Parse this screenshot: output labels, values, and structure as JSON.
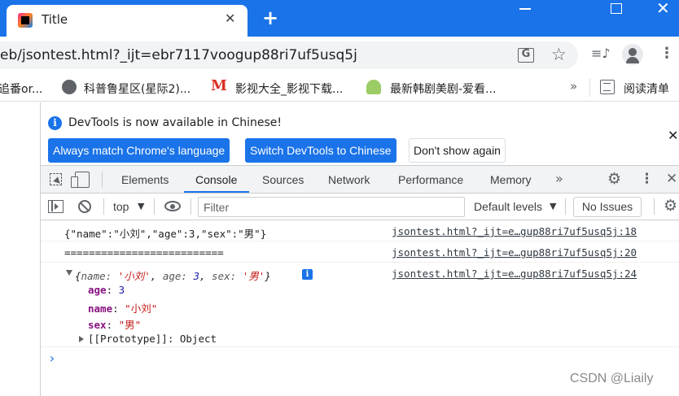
{
  "browser": {
    "tab_title": "Title",
    "url": "eb/jsontest.html?_ijt=ebr7117voogup88ri7uf5usq5j"
  },
  "bookmarks": {
    "items": [
      {
        "label": "追番or...",
        "icon": "folder-icon"
      },
      {
        "label": "科普鲁星区(星际2)...",
        "icon": "globe-icon"
      },
      {
        "label": "影视大全_影视下载...",
        "icon": "m-logo-icon"
      },
      {
        "label": "最新韩剧美剧-爱看...",
        "icon": "android-icon"
      }
    ],
    "more": "»",
    "reading_list": "阅读清单"
  },
  "devtools": {
    "infobar": {
      "message": "DevTools is now available in Chinese!",
      "btn_match": "Always match Chrome's language",
      "btn_switch": "Switch DevTools to Chinese",
      "btn_dismiss": "Don't show again"
    },
    "tabs": [
      {
        "label": "Elements"
      },
      {
        "label": "Console",
        "active": true
      },
      {
        "label": "Sources"
      },
      {
        "label": "Network"
      },
      {
        "label": "Performance"
      },
      {
        "label": "Memory"
      }
    ],
    "more_tabs": "»",
    "console_toolbar": {
      "context": "top",
      "filter_placeholder": "Filter",
      "levels": "Default levels",
      "issues": "No Issues"
    },
    "console": {
      "messages": [
        {
          "text": "{\"name\":\"小刘\",\"age\":3,\"sex\":\"男\"}",
          "source": "jsontest.html?_ijt=e…gup88ri7uf5usq5j:18"
        },
        {
          "text": "==========================",
          "source": "jsontest.html?_ijt=e…gup88ri7uf5usq5j:20"
        },
        {
          "source": "jsontest.html?_ijt=e…gup88ri7uf5usq5j:24"
        }
      ],
      "object_preview": {
        "open": "{",
        "k1": "name: ",
        "v1": "'小刘'",
        "sep1": ", ",
        "k2": "age: ",
        "v2": "3",
        "sep2": ", ",
        "k3": "sex: ",
        "v3": "'男'",
        "close": "}"
      },
      "properties": [
        {
          "key": "age",
          "value": "3",
          "kind": "number"
        },
        {
          "key": "name",
          "value": "\"小刘\"",
          "kind": "string"
        },
        {
          "key": "sex",
          "value": "\"男\"",
          "kind": "string"
        }
      ],
      "prototype": "[[Prototype]]: Object",
      "prompt": "›"
    }
  },
  "watermark": "CSDN @Liaily",
  "colors": {
    "titlebar": "#1a73e8",
    "accent": "#1a73e8",
    "string": "#c41a16",
    "number": "#1a1aa6",
    "prop_key": "#881280"
  }
}
